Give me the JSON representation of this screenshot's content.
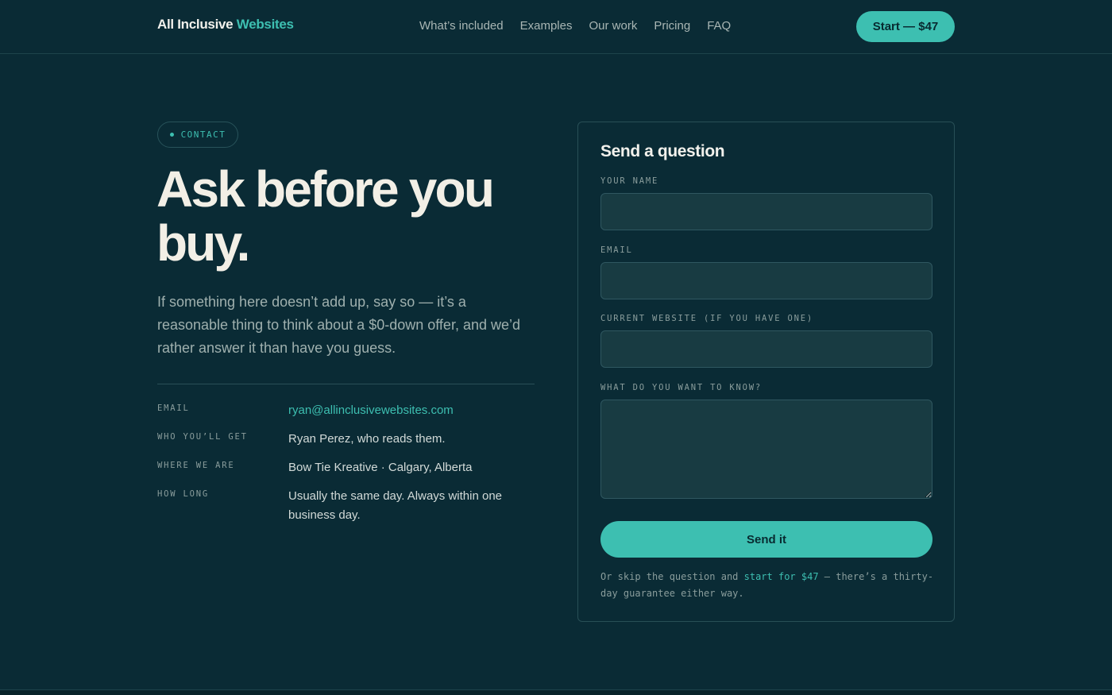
{
  "header": {
    "logo_main": "All Inclusive",
    "logo_accent": "Websites",
    "nav": [
      "What’s included",
      "Examples",
      "Our work",
      "Pricing",
      "FAQ"
    ],
    "cta_label": "Start — $47"
  },
  "hero": {
    "tag": "CONTACT",
    "headline": "Ask before you buy.",
    "lede": "If something here doesn’t add up, say so — it’s a reasonable thing to think about a $0-down offer, and we’d rather answer it than have you guess."
  },
  "info": [
    {
      "key": "EMAIL",
      "value": "ryan@allinclusivewebsites.com"
    },
    {
      "key": "WHO YOU’LL GET",
      "value": "Ryan Perez, who reads them."
    },
    {
      "key": "WHERE WE ARE",
      "value": "Bow Tie Kreative · Calgary, Alberta"
    },
    {
      "key": "HOW LONG",
      "value": "Usually the same day. Always within one business day."
    }
  ],
  "form": {
    "title": "Send a question",
    "name_label": "YOUR NAME",
    "name_value": "",
    "email_label": "EMAIL",
    "email_value": "",
    "website_label": "CURRENT WEBSITE (IF YOU HAVE ONE)",
    "website_value": "",
    "question_label": "WHAT DO YOU WANT TO KNOW?",
    "question_value": "",
    "submit_label": "Send it",
    "note_before": "Or skip the question and ",
    "note_link": "start for $47",
    "note_after": " — there’s a thirty-day guarantee either way."
  },
  "colors": {
    "background": "#0a2b35",
    "accent": "#3dbfb1",
    "field_bg": "#183b42"
  }
}
